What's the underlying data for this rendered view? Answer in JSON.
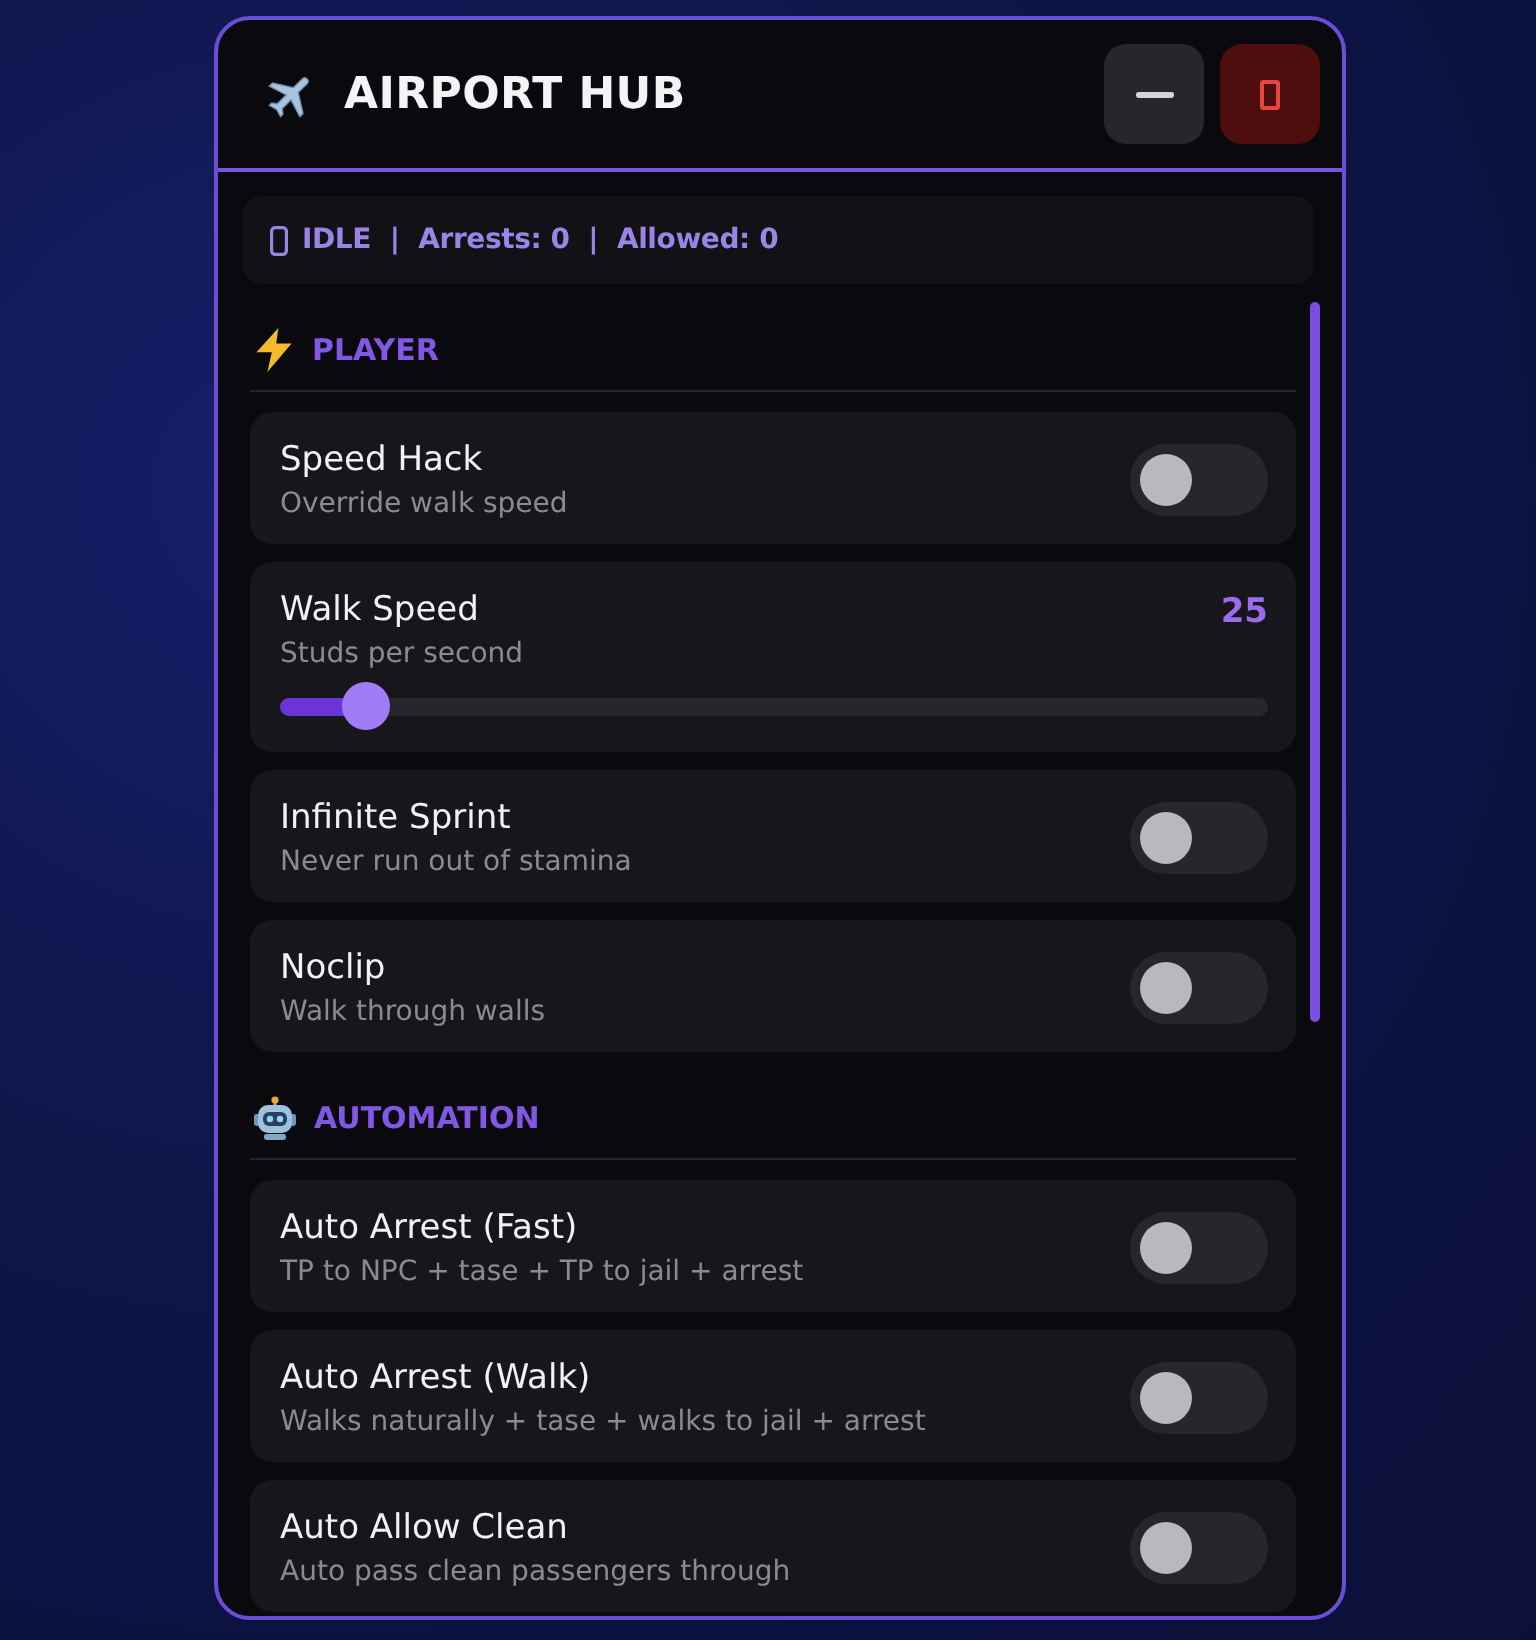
{
  "window": {
    "title": "AIRPORT HUB"
  },
  "status_bar": {
    "text": "IDLE  |  Arrests: 0  |  Allowed: 0"
  },
  "sections": [
    {
      "title": "PLAYER",
      "items": [
        {
          "kind": "toggle",
          "title": "Speed Hack",
          "description": "Override walk speed",
          "on": false
        },
        {
          "kind": "slider",
          "title": "Walk Speed",
          "description": "Studs per second",
          "value": "25",
          "level": 0.067
        },
        {
          "kind": "toggle",
          "title": "Infinite Sprint",
          "description": "Never run out of stamina",
          "on": false
        },
        {
          "kind": "toggle",
          "title": "Noclip",
          "description": "Walk through walls",
          "on": false
        }
      ]
    },
    {
      "title": "AUTOMATION",
      "items": [
        {
          "kind": "toggle",
          "title": "Auto Arrest (Fast)",
          "description": "TP to NPC + tase + TP to jail + arrest",
          "on": false
        },
        {
          "kind": "toggle",
          "title": "Auto Arrest (Walk)",
          "description": "Walks naturally + tase + walks to jail + arrest",
          "on": false
        },
        {
          "kind": "toggle",
          "title": "Auto Allow Clean",
          "description": "Auto pass clean passengers through",
          "on": false
        }
      ]
    }
  ]
}
